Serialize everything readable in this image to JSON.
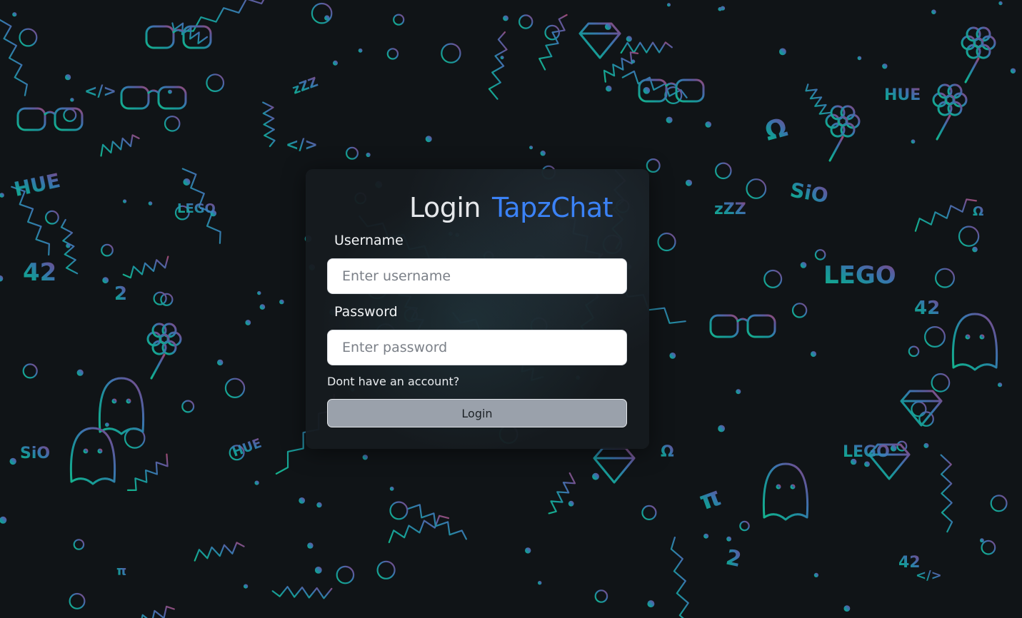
{
  "header": {
    "title_primary": "Login",
    "title_brand": "TapzChat"
  },
  "form": {
    "username_label": "Username",
    "username_placeholder": "Enter username",
    "username_value": "",
    "password_label": "Password",
    "password_placeholder": "Enter password",
    "password_value": "",
    "signup_link": "Dont have an account?",
    "submit_label": "Login"
  },
  "background": {
    "texts": [
      "HUE",
      "SiO",
      "2",
      "42",
      "LEGO",
      "Ω",
      "π",
      "</>",
      "HUE",
      "SiO",
      "2",
      "42",
      "LEGO",
      "Ω",
      "π",
      "</>",
      "zZZ",
      "HUE",
      "42",
      "LEGO",
      "Ω",
      "</>",
      "zZZ"
    ],
    "icons": [
      "ghost-icon",
      "flower-icon",
      "glasses-icon",
      "spider-icon",
      "atom-icon",
      "diamond-icon",
      "guitar-icon",
      "wifi-icon",
      "cube-icon",
      "paw-icon",
      "sun-icon",
      "rainbow-icon",
      "skull-icon",
      "github-icon",
      "pen-icon",
      "gamepad-icon",
      "dice-icon",
      "rose-icon",
      "mermaid-icon",
      "pineapple-icon",
      "pepper-icon",
      "phoenix-icon",
      "venus-icon",
      "mars-icon",
      "bowtie-icon",
      "popcorn-icon"
    ]
  },
  "colors": {
    "brand": "#3b82f6",
    "card_bg": "#161b1f",
    "button_bg": "#9aa1ab",
    "bg_teal": "#14b8a6",
    "bg_blue": "#3f7fbf",
    "bg_purple": "#7a5a9a",
    "bg_pink": "#b0507a"
  }
}
